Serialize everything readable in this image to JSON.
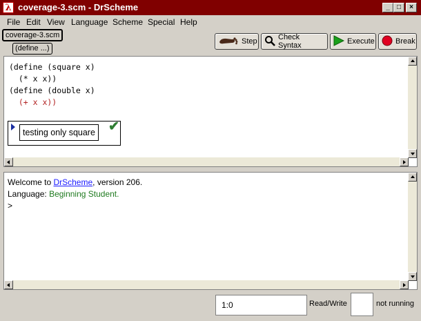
{
  "window": {
    "title": "coverage-3.scm - DrScheme",
    "app_icon_glyph": "λ",
    "controls": {
      "minimize": "_",
      "maximize": "□",
      "close": "×"
    }
  },
  "menu": [
    "File",
    "Edit",
    "View",
    "Language",
    "Scheme",
    "Special",
    "Help"
  ],
  "tabs": {
    "file_tab": "coverage-3.scm",
    "define_menu": "(define ...)"
  },
  "toolbar": {
    "step_label": "Step",
    "step_icon": "foot-icon",
    "check_syntax_label": "Check Syntax",
    "check_syntax_icon": "magnifier-icon",
    "execute_label": "Execute",
    "execute_icon": "green-arrow-icon",
    "break_label": "Break",
    "break_icon": "stop-icon"
  },
  "definitions": {
    "lines": [
      "(define (square x)",
      "  (* x x))",
      "(define (double x)",
      "  (+ x x))"
    ],
    "uncovered_color": "#b22222",
    "test_snip": {
      "label": "testing only square",
      "status_icon": "check-icon",
      "status_color": "#2e7d32"
    }
  },
  "interactions": {
    "welcome_prefix": "Welcome to ",
    "welcome_link": "DrScheme",
    "welcome_suffix": ", version 206.",
    "language_label": "Language: ",
    "language_value": "Beginning Student.",
    "prompt": ">"
  },
  "status": {
    "position": "1:0",
    "mode": "Read/Write",
    "running": "not running"
  }
}
